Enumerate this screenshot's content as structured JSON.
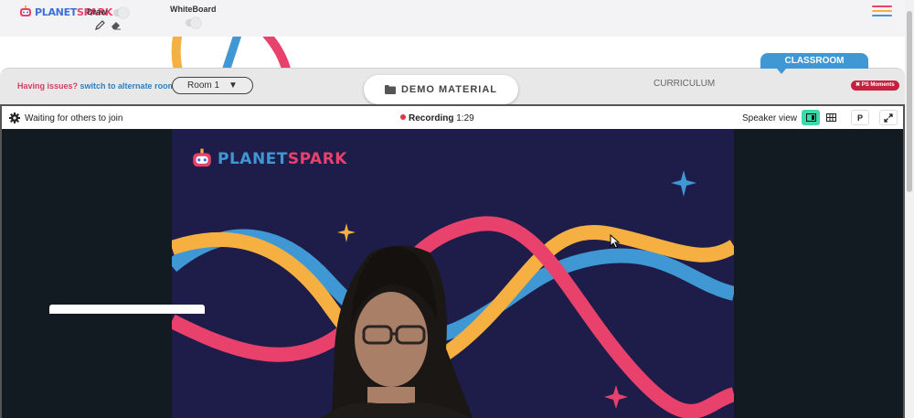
{
  "header": {
    "brand": {
      "part1": "PLANET",
      "part2": "SPARK"
    },
    "draw_label": "Draw",
    "whiteboard_label": "WhiteBoard",
    "icons": [
      "pencil-icon",
      "eraser-icon",
      "hamburger-icon"
    ],
    "menu_colors": [
      "#e8426c",
      "#f5b041",
      "#3f97d3"
    ]
  },
  "toolbar": {
    "issues_question": "Having issues?",
    "issues_link": "switch to alternate room",
    "room_value": "Room 1",
    "demo_button": "DEMO MATERIAL",
    "curriculum_tab": "CURRICULUM",
    "classroom_tab": "CLASSROOM",
    "ps_moments": "PS Moments"
  },
  "video": {
    "status": "Waiting for others to join",
    "recording_label": "Recording",
    "recording_time": "1:29",
    "view_mode": "Speaker view",
    "p_button": "P",
    "slide_brand": {
      "part1": "PLANET",
      "part2": "SPARK"
    }
  },
  "colors": {
    "brand_blue": "#3c6fd8",
    "brand_pink": "#e8426c",
    "accent_blue": "#3f97d3",
    "accent_yellow": "#f5b041",
    "slide_bg": "#1e1c49",
    "active_view": "#3dd9a8"
  }
}
